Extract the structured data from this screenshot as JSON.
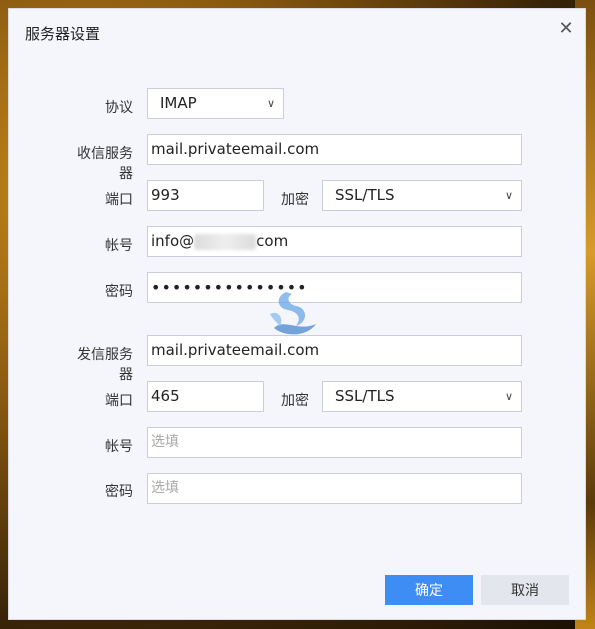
{
  "dialog": {
    "title": "服务器设置",
    "close_glyph": "✕"
  },
  "incoming": {
    "protocol_label": "协议",
    "protocol_value": "IMAP",
    "server_label": "收信服务器",
    "server_value": "mail.privateemail.com",
    "port_label": "端口",
    "port_value": "993",
    "encrypt_label": "加密",
    "encrypt_value": "SSL/TLS",
    "account_label": "帐号",
    "account_prefix": "info@",
    "account_suffix": "com",
    "password_label": "密码",
    "password_mask": "•••••••••••••••"
  },
  "outgoing": {
    "server_label": "发信服务器",
    "server_value": "mail.privateemail.com",
    "port_label": "端口",
    "port_value": "465",
    "encrypt_label": "加密",
    "encrypt_value": "SSL/TLS",
    "account_label": "帐号",
    "account_placeholder": "选填",
    "password_label": "密码",
    "password_placeholder": "选填"
  },
  "buttons": {
    "ok": "确定",
    "cancel": "取消"
  },
  "icons": {
    "chevron": "chevron-down-icon",
    "close": "close-icon"
  },
  "colors": {
    "primary": "#3d8df5",
    "dialog_bg": "#f4f6fb"
  }
}
